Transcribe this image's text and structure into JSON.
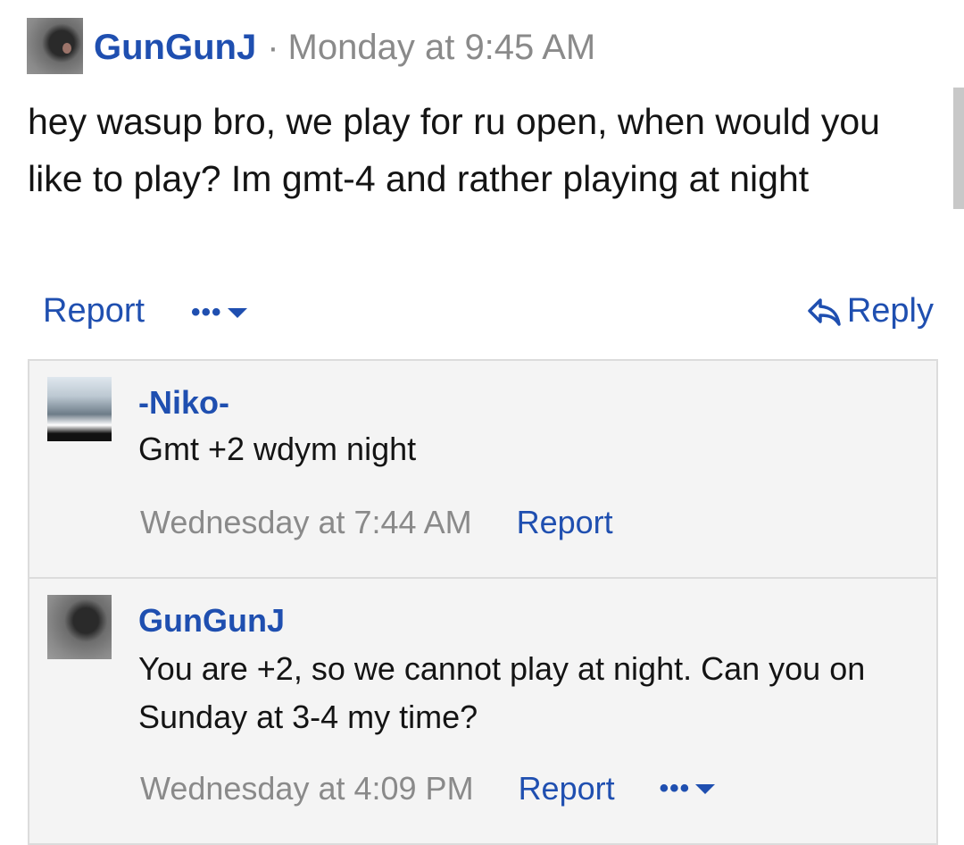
{
  "post": {
    "author": "GunGunJ",
    "separator": "·",
    "time": "Monday at 9:45 AM",
    "body": "hey wasup bro, we play for ru open, when would you like to play? Im gmt-4 and rather playing at night",
    "actions": {
      "report": "Report",
      "more": "•••",
      "reply": "Reply"
    }
  },
  "comments": [
    {
      "author": "-Niko-",
      "text": "Gmt +2 wdym night",
      "time": "Wednesday at 7:44 AM",
      "report": "Report"
    },
    {
      "author": "GunGunJ",
      "text": "You are +2, so we cannot play at night. Can you on Sunday at 3-4 my time?",
      "time": "Wednesday at 4:09 PM",
      "report": "Report",
      "more": "•••"
    }
  ],
  "colors": {
    "link": "#1f4fb0",
    "muted": "#8a8a8a",
    "comment_bg": "#f4f4f4",
    "border": "#dcdcdc"
  }
}
